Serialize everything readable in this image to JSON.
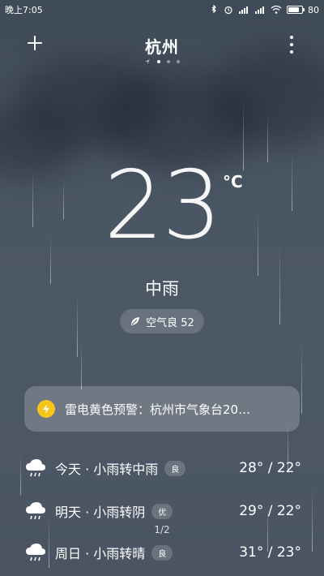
{
  "status_bar": {
    "time": "晚上7:05",
    "battery": "80"
  },
  "header": {
    "city": "杭州",
    "page_count": 4,
    "active_page": 1
  },
  "current": {
    "temperature": "23",
    "unit": "°C",
    "condition": "中雨",
    "aqi_label": "空气良 52"
  },
  "alert": {
    "text": "雷电黄色预警：杭州市气象台20…",
    "icon": "lightning-icon"
  },
  "forecast": [
    {
      "label": "今天 · 小雨转中雨",
      "aqi": "良",
      "temps": "28° / 22°",
      "icon": "rain-cloud-icon"
    },
    {
      "label": "明天 · 小雨转阴",
      "aqi": "优",
      "temps": "29° / 22°",
      "icon": "rain-cloud-icon"
    },
    {
      "label": "周日 · 小雨转晴",
      "aqi": "良",
      "temps": "31° / 23°",
      "icon": "rain-cloud-icon"
    }
  ],
  "pager": "1/2",
  "colors": {
    "background": "#4a5563",
    "alert_icon": "#f5c518"
  }
}
